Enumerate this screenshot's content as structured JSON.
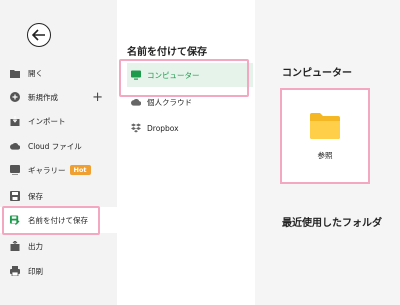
{
  "sidebar": {
    "items": [
      {
        "label": "開く",
        "icon": "folder-icon"
      },
      {
        "label": "新規作成",
        "icon": "plus-circle-icon"
      },
      {
        "label": "インポート",
        "icon": "import-icon"
      },
      {
        "label": "Cloud ファイル",
        "icon": "cloud-icon"
      },
      {
        "label": "ギャラリー",
        "icon": "gallery-icon",
        "badge": "Hot"
      },
      {
        "label": "保存",
        "icon": "save-icon"
      },
      {
        "label": "名前を付けて保存",
        "icon": "save-as-icon"
      },
      {
        "label": "出力",
        "icon": "export-icon"
      },
      {
        "label": "印刷",
        "icon": "print-icon"
      }
    ],
    "new_plus": "+"
  },
  "middle": {
    "title": "名前を付けて保存",
    "locations": [
      {
        "label": "コンピューター",
        "icon": "monitor-icon"
      },
      {
        "label": "個人クラウド",
        "icon": "cloud-icon"
      },
      {
        "label": "Dropbox",
        "icon": "dropbox-icon"
      }
    ]
  },
  "right": {
    "title": "コンピューター",
    "browse_label": "参照",
    "recent_title": "最近使用したフォルダ"
  },
  "colors": {
    "highlight": "#f4a7c0",
    "accent_green": "#1a9a4a",
    "hot": "#f0a030",
    "folder": "#f5b824"
  }
}
